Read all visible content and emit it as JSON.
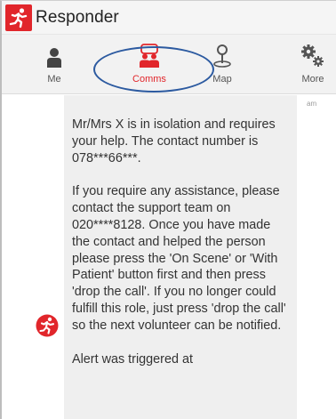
{
  "app": {
    "title": "Responder",
    "brand_color": "#e1262b",
    "logo_icon": "running-person-icon"
  },
  "tabs": [
    {
      "label": "Me",
      "icon": "person-icon",
      "active": false
    },
    {
      "label": "Comms",
      "icon": "group-chat-icon",
      "active": true
    },
    {
      "label": "Map",
      "icon": "map-pin-icon",
      "active": false
    },
    {
      "label": "More",
      "icon": "gears-icon",
      "active": false
    }
  ],
  "annotation": {
    "color": "#2c5aa0",
    "target": "Comms"
  },
  "message": {
    "sender_icon": "running-person-avatar-icon",
    "side_stamp": "am",
    "paragraphs": [
      "Mr/Mrs X is in isolation and requires your help. The contact number is  078***66***.",
      "If you require any assistance, please contact the support team on 020****8128. Once you have made the contact and helped the person please press the 'On Scene' or 'With Patient' button first and then press 'drop the call'. If you no longer could fulfill this role, just press 'drop the call' so the next volunteer can be notified.",
      "Alert was triggered at"
    ]
  }
}
